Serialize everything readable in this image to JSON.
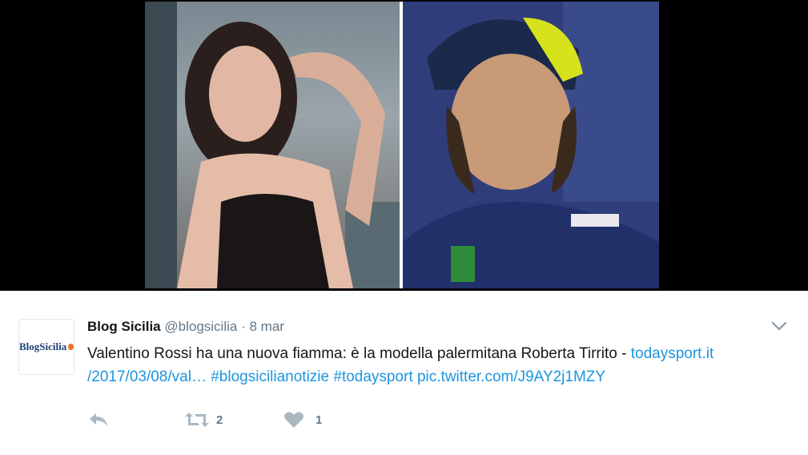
{
  "tweet": {
    "author_name": "Blog Sicilia",
    "handle": "@blogsicilia",
    "separator": "·",
    "date": "8 mar",
    "text_before": "Valentino Rossi ha una nuova fiamma: è la modella palermitana Roberta Tirrito - ",
    "link_1": "todaysport.it",
    "link_1_cont": "/2017/03/08/val…",
    "hashtag_1": "#blogsicilianotizie",
    "hashtag_2": "#todaysport",
    "pic_link": "pic.twitter.com/J9AY2j1MZY",
    "avatar_text": "BlogSicilia",
    "retweets": "2",
    "likes": "1"
  },
  "icons": {
    "reply": "reply-icon",
    "retweet": "retweet-icon",
    "like": "heart-icon",
    "more": "chevron-down-icon"
  },
  "colors": {
    "link": "#1b95e0",
    "muted": "#657786",
    "icon": "#aab8c2"
  }
}
